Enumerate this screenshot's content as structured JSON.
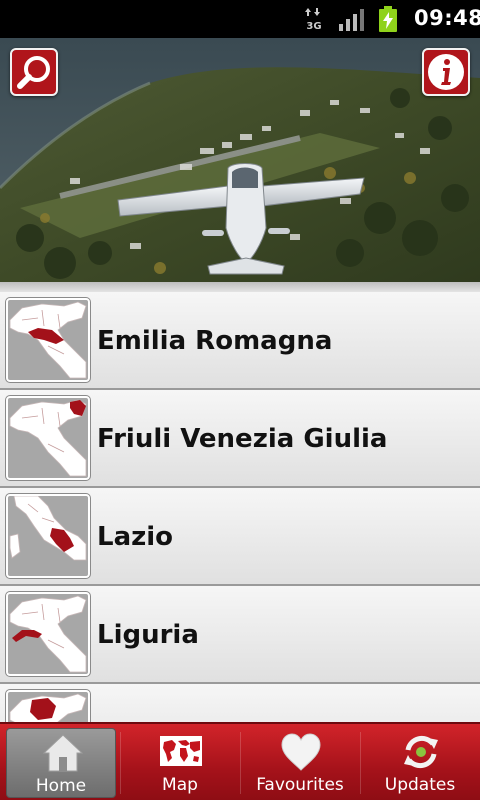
{
  "status_bar": {
    "network": "3G",
    "time": "09:48"
  },
  "header": {
    "search_icon": "search-icon",
    "info_icon": "info-icon"
  },
  "regions": [
    {
      "name": "Emilia Romagna"
    },
    {
      "name": "Friuli Venezia Giulia"
    },
    {
      "name": "Lazio"
    },
    {
      "name": "Liguria"
    },
    {
      "name": ""
    }
  ],
  "tabs": [
    {
      "label": "Home",
      "icon": "home-icon",
      "active": true
    },
    {
      "label": "Map",
      "icon": "world-map-icon",
      "active": false
    },
    {
      "label": "Favourites",
      "icon": "heart-icon",
      "active": false
    },
    {
      "label": "Updates",
      "icon": "refresh-icon",
      "active": false
    }
  ],
  "colors": {
    "accent_red": "#b0151b",
    "region_highlight": "#a3111a",
    "list_bg": "#e6e6e6"
  }
}
